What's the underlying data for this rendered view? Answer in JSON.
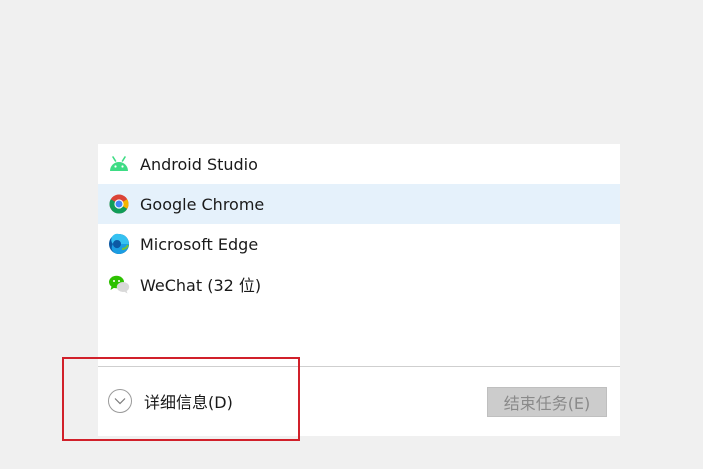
{
  "apps": [
    {
      "name": "Android Studio",
      "icon": "android-icon"
    },
    {
      "name": "Google Chrome",
      "icon": "chrome-icon",
      "selected": true
    },
    {
      "name": "Microsoft Edge",
      "icon": "edge-icon"
    },
    {
      "name": "WeChat (32 位)",
      "icon": "wechat-icon"
    }
  ],
  "footer": {
    "details_label": "详细信息(D)",
    "end_task_label": "结束任务(E)"
  },
  "colors": {
    "selected_row": "#e5f1fb",
    "highlight_box": "#d1202a",
    "android_green": "#3ddc84",
    "wechat_green": "#2dc100"
  }
}
